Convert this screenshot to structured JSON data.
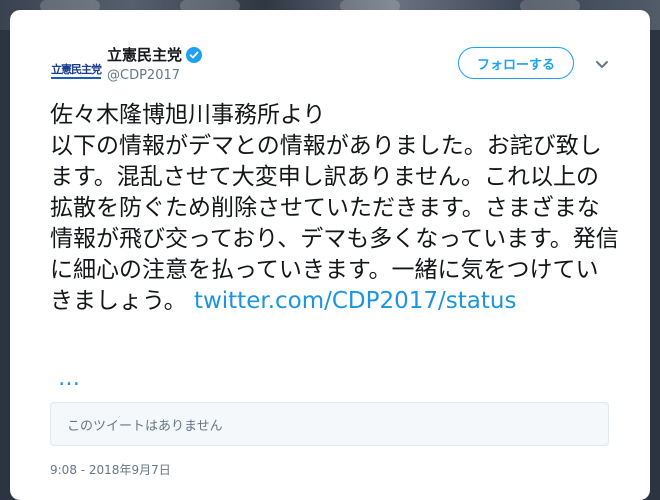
{
  "account": {
    "display_name": "立憲民主党",
    "handle": "@CDP2017",
    "avatar_text": "立憲民主党",
    "verified": true
  },
  "actions": {
    "follow_label": "フォローする"
  },
  "icons": {
    "verified": "verified-badge-icon",
    "menu": "chevron-down-icon"
  },
  "tweet": {
    "text": "佐々木隆博旭川事務所より\n以下の情報がデマとの情報がありました。お詫び致します。混乱させて大変申し訳ありません。これ以上の拡散を防ぐため削除させていただきます。さまざまな情報が飛び交っており、デマも多くなっています。発信に細心の注意を払っていきます。一緒に気をつけていきましょう。 ",
    "link": "twitter.com/CDP2017/status",
    "ellipsis": "…",
    "quote_unavailable": "このツイートはありません",
    "timestamp": "9:08 - 2018年9月7日"
  },
  "colors": {
    "accent": "#1da1f2",
    "link": "#1b95e0",
    "secondary_text": "#657786"
  }
}
